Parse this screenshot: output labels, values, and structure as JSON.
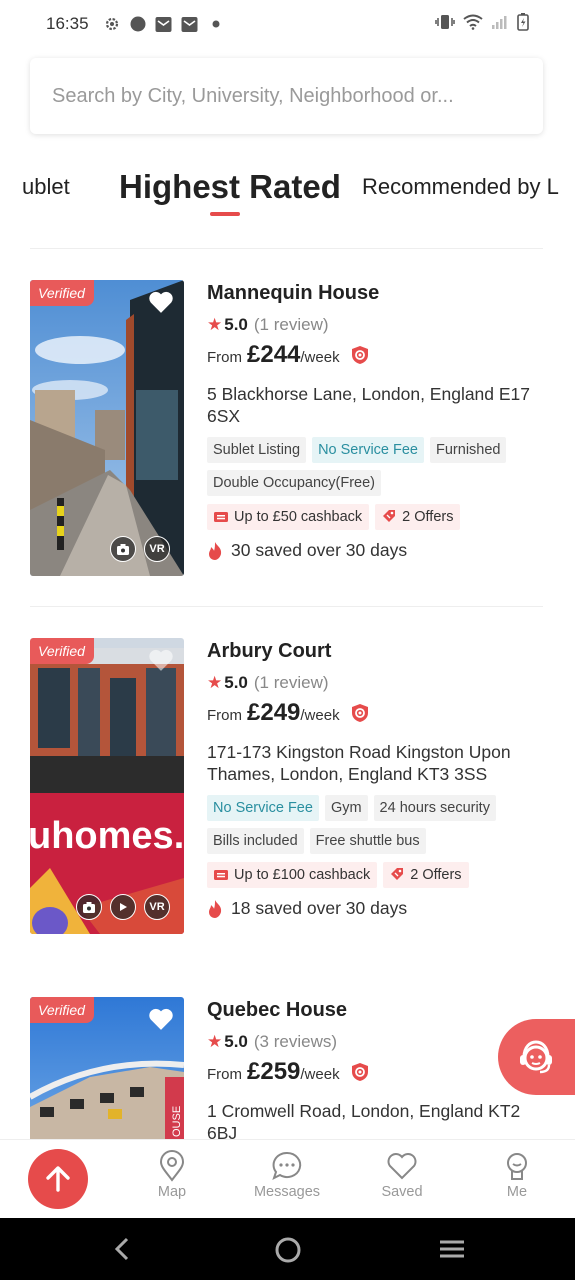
{
  "status_bar": {
    "time": "16:35"
  },
  "search": {
    "placeholder": "Search by City, University, Neighborhood or..."
  },
  "tabs": [
    {
      "label": "Sublet",
      "visible_text": "ublet"
    },
    {
      "label": "Highest Rated"
    },
    {
      "label": "Recommended by L"
    }
  ],
  "listings": [
    {
      "verified": "Verified",
      "title": "Mannequin House",
      "rating": "5.0",
      "reviews": "(1 review)",
      "price_prefix": "From",
      "price": "£244",
      "price_suffix": "/week",
      "address": "5 Blackhorse Lane, London, England E17 6SX",
      "tags": [
        "Sublet Listing",
        "No Service Fee",
        "Furnished",
        "Double Occupancy(Free)"
      ],
      "highlight_tags": [
        "No Service Fee"
      ],
      "cashback": "Up to £50 cashback",
      "offers": "2 Offers",
      "saved": "30 saved over 30 days",
      "media": [
        "VR"
      ]
    },
    {
      "verified": "Verified",
      "title": "Arbury Court",
      "rating": "5.0",
      "reviews": "(1 review)",
      "price_prefix": "From",
      "price": "£249",
      "price_suffix": "/week",
      "address": "171-173 Kingston Road Kingston Upon Thames, London, England KT3 3SS",
      "tags": [
        "No Service Fee",
        "Gym",
        "24 hours security",
        "Bills included",
        "Free shuttle bus"
      ],
      "highlight_tags": [
        "No Service Fee"
      ],
      "cashback": "Up to £100 cashback",
      "offers": "2 Offers",
      "saved": "18 saved over 30 days",
      "media": [
        "VR"
      ],
      "photo_sign_text": "uhomes.c"
    },
    {
      "verified": "Verified",
      "title": "Quebec House",
      "rating": "5.0",
      "reviews": "(3 reviews)",
      "price_prefix": "From",
      "price": "£259",
      "price_suffix": "/week",
      "address": "1 Cromwell Road, London, England KT2 6BJ",
      "photo_sign_text": "OUSE"
    }
  ],
  "bottom_nav": {
    "items": [
      {
        "label": "Map",
        "icon": "map-pin-icon"
      },
      {
        "label": "Messages",
        "icon": "chat-bubble-icon"
      },
      {
        "label": "Saved",
        "icon": "heart-icon"
      },
      {
        "label": "Me",
        "icon": "person-icon"
      }
    ]
  },
  "colors": {
    "accent": "#e64b4b",
    "highlight_tag_bg": "#e6f4f6",
    "highlight_tag_text": "#2a8fa0",
    "perk_bg": "#fdeeee"
  }
}
